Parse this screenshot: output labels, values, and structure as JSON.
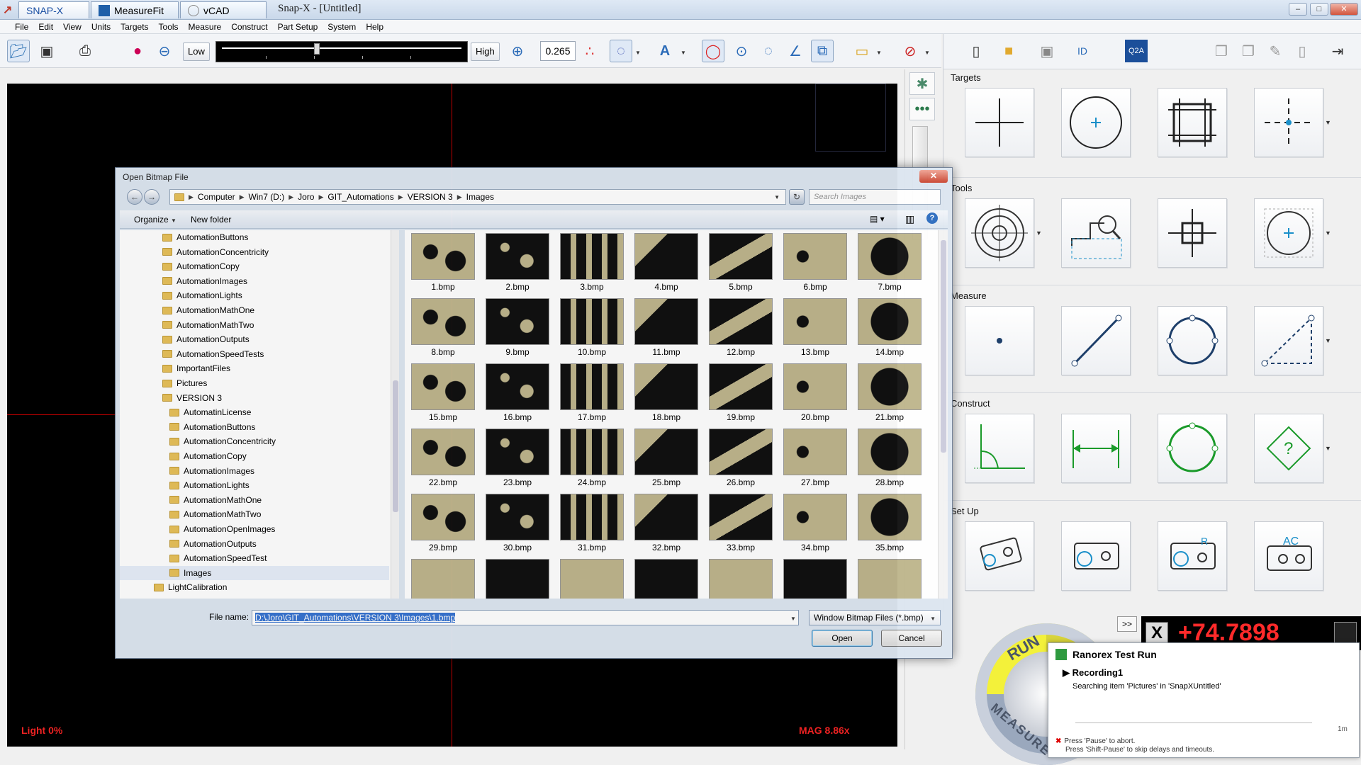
{
  "titlebar": {
    "tabs": [
      {
        "label": "SNAP-X"
      },
      {
        "label": "MeasureFit"
      },
      {
        "label": "vCAD"
      }
    ],
    "caption": "Snap-X - [Untitled]"
  },
  "menu": [
    "File",
    "Edit",
    "View",
    "Units",
    "Targets",
    "Tools",
    "Measure",
    "Construct",
    "Part Setup",
    "System",
    "Help"
  ],
  "toolbar": {
    "low_label": "Low",
    "high_label": "High",
    "zoom_value": "0.265"
  },
  "viewport": {
    "light_label": "Light   0%",
    "mag_label": "MAG 8.86x"
  },
  "panel": {
    "sections": {
      "targets": "Targets",
      "tools": "Tools",
      "measure": "Measure",
      "construct": "Construct",
      "setup": "Set Up"
    }
  },
  "dro": {
    "value": "+74.7898",
    "x_label": "X",
    "more_label": ">>"
  },
  "run": {
    "run_text": "RUN",
    "measure_text": "MEASURE"
  },
  "ranorex": {
    "title": "Ranorex Test Run",
    "recording": "Recording1",
    "message": "Searching item 'Pictures' in 'SnapXUntitled'",
    "time": "1m",
    "foot1": "Press 'Pause' to abort.",
    "foot2": "Press 'Shift-Pause' to skip delays and timeouts."
  },
  "dialog": {
    "title": "Open Bitmap File",
    "breadcrumb": [
      "Computer",
      "Win7 (D:)",
      "Joro",
      "GIT_Automations",
      "VERSION 3",
      "Images"
    ],
    "search_placeholder": "Search Images",
    "organize_label": "Organize",
    "newfolder_label": "New folder",
    "tree_top": [
      "AutomationButtons",
      "AutomationConcentricity",
      "AutomationCopy",
      "AutomationImages",
      "AutomationLights",
      "AutomationMathOne",
      "AutomationMathTwo",
      "AutomationOutputs",
      "AutomationSpeedTests",
      "ImportantFiles",
      "Pictures"
    ],
    "tree_version": "VERSION 3",
    "tree_sub": [
      "AutomatinLicense",
      "AutomationButtons",
      "AutomationConcentricity",
      "AutomationCopy",
      "AutomationImages",
      "AutomationLights",
      "AutomationMathOne",
      "AutomationMathTwo",
      "AutomationOpenImages",
      "AutomationOutputs",
      "AutomationSpeedTest",
      "Images"
    ],
    "tree_bottom": "LightCalibration",
    "files": [
      "1.bmp",
      "2.bmp",
      "3.bmp",
      "4.bmp",
      "5.bmp",
      "6.bmp",
      "7.bmp",
      "8.bmp",
      "9.bmp",
      "10.bmp",
      "11.bmp",
      "12.bmp",
      "13.bmp",
      "14.bmp",
      "15.bmp",
      "16.bmp",
      "17.bmp",
      "18.bmp",
      "19.bmp",
      "20.bmp",
      "21.bmp",
      "22.bmp",
      "23.bmp",
      "24.bmp",
      "25.bmp",
      "26.bmp",
      "27.bmp",
      "28.bmp",
      "29.bmp",
      "30.bmp",
      "31.bmp",
      "32.bmp",
      "33.bmp",
      "34.bmp",
      "35.bmp"
    ],
    "filename_label": "File name:",
    "filename_value": "D:\\Joro\\GIT_Automations\\VERSION 3\\Images\\1.bmp",
    "filetype": "Window Bitmap Files (*.bmp)",
    "open_label": "Open",
    "cancel_label": "Cancel"
  }
}
